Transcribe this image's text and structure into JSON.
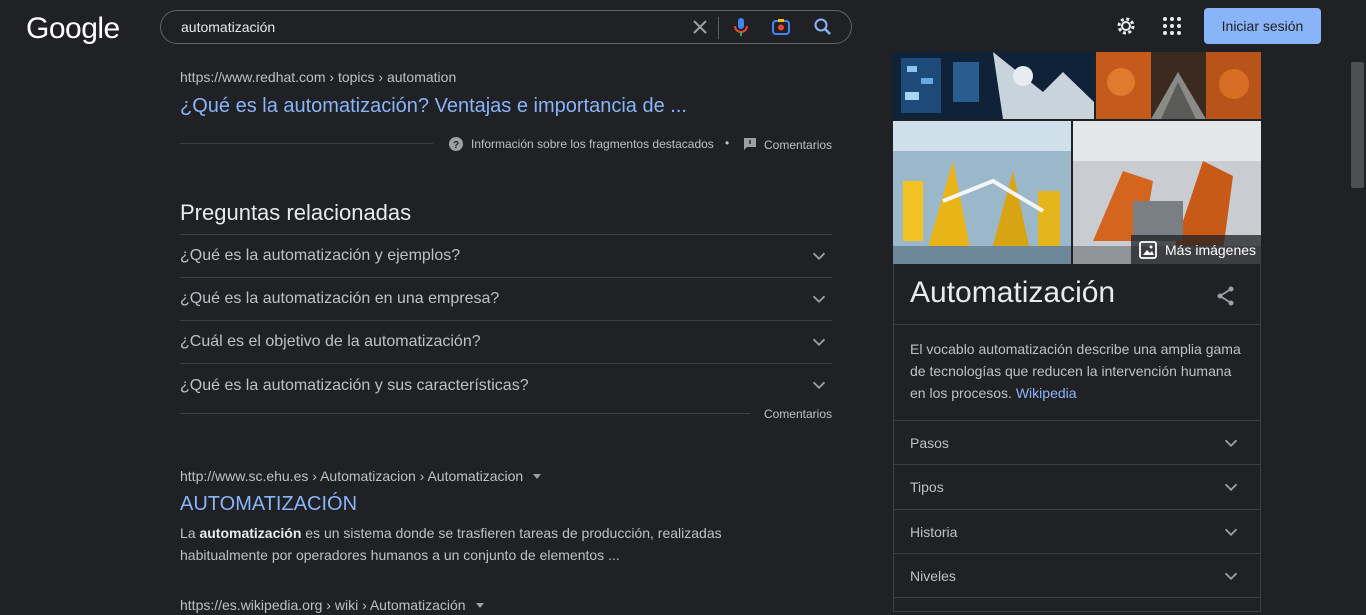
{
  "header": {
    "logo": "Google",
    "search_value": "automatización",
    "signin_label": "Iniciar sesión",
    "colors": {
      "accent": "#8ab4f8",
      "background": "#202124"
    }
  },
  "result1": {
    "cite_domain": "https://www.redhat.com",
    "cite_path": " › topics › automation",
    "title": "¿Qué es la automatización? Ventajas e importancia de ...",
    "snippet_info": "Información sobre los fragmentos destacados",
    "bullet": "•",
    "comments": "Comentarios"
  },
  "paa": {
    "title": "Preguntas relacionadas",
    "items": [
      "¿Qué es la automatización y ejemplos?",
      "¿Qué es la automatización en una empresa?",
      "¿Cuál es el objetivo de la automatización?",
      "¿Qué es la automatización y sus características?"
    ],
    "comments": "Comentarios"
  },
  "result2": {
    "cite_domain": "http://www.sc.ehu.es",
    "cite_path": " › Automatizacion › Automatizacion",
    "title": "AUTOMATIZACIÓN",
    "desc_pre": "La ",
    "desc_bold": "automatización",
    "desc_post": " es un sistema donde se trasfieren tareas de producción, realizadas habitualmente por operadores humanos a un conjunto de elementos ..."
  },
  "result3": {
    "cite_domain": "https://es.wikipedia.org",
    "cite_path": " › wiki › Automatización"
  },
  "knowledge_panel": {
    "more_images": "Más imágenes",
    "title": "Automatización",
    "description": "El vocablo automatización describe una amplia gama de tecnologías que reducen la intervención humana en los procesos. ",
    "source_link": "Wikipedia",
    "rows": [
      "Pasos",
      "Tipos",
      "Historia",
      "Niveles"
    ]
  },
  "icons": [
    "clear-icon",
    "mic-icon",
    "lens-icon",
    "search-icon",
    "gear-icon",
    "apps-icon",
    "help-icon",
    "feedback-icon",
    "chevron-down-icon",
    "share-icon",
    "image-icon"
  ]
}
